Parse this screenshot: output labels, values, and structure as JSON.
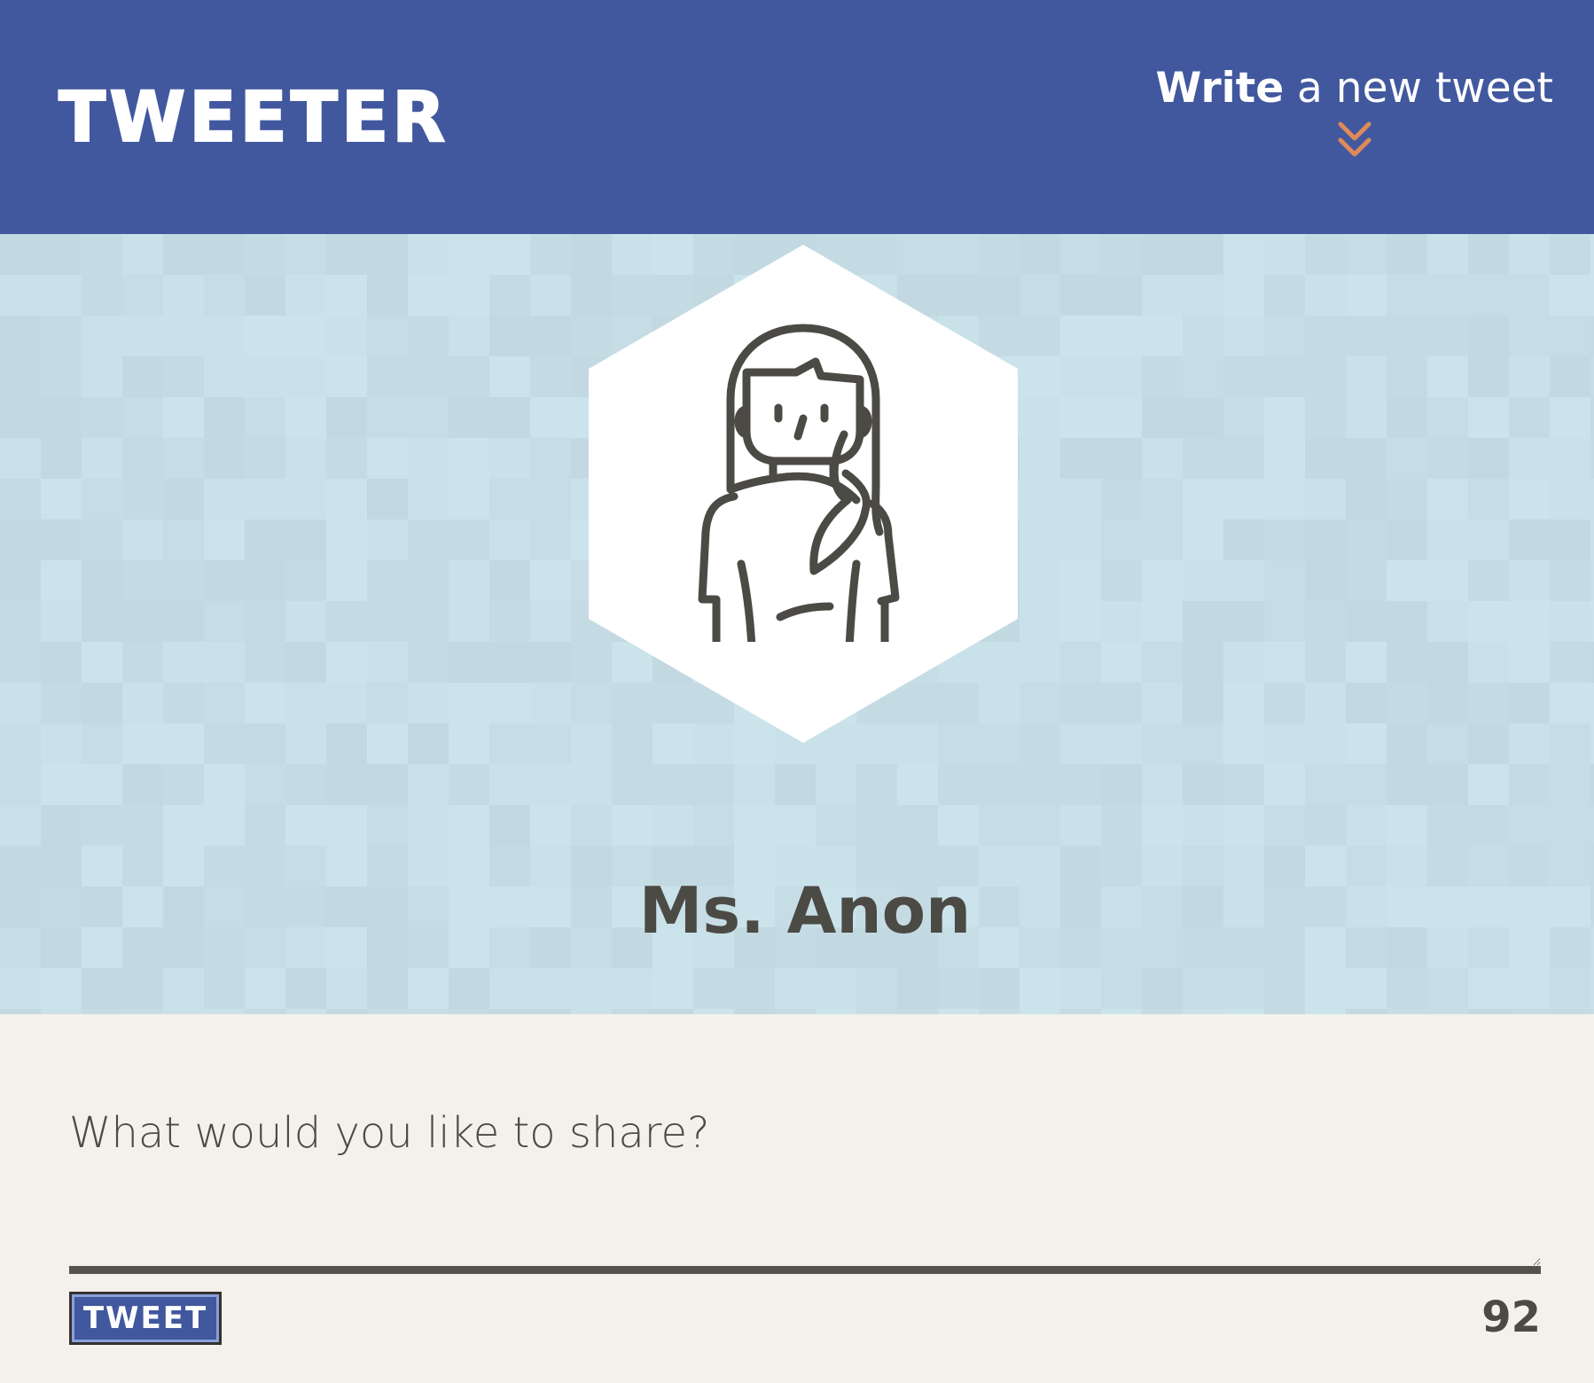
{
  "app": {
    "brand": "TWEETER"
  },
  "nav": {
    "compose_strong": "Write",
    "compose_rest": " a new tweet",
    "chevron_icon": "double-chevron-down-icon",
    "chevron_color": "#e08a5a"
  },
  "profile": {
    "name": "Ms. Anon",
    "avatar_icon": "woman-avatar-icon"
  },
  "composer": {
    "placeholder": "What would you like to share?",
    "value": "",
    "button_label": "TWEET",
    "char_count": "92"
  },
  "colors": {
    "navbar": "#41589e",
    "profile_background": "#c7dfe7",
    "composer_background": "#f4f1ec",
    "text_dark": "#4c4a45",
    "accent": "#e08a5a"
  }
}
